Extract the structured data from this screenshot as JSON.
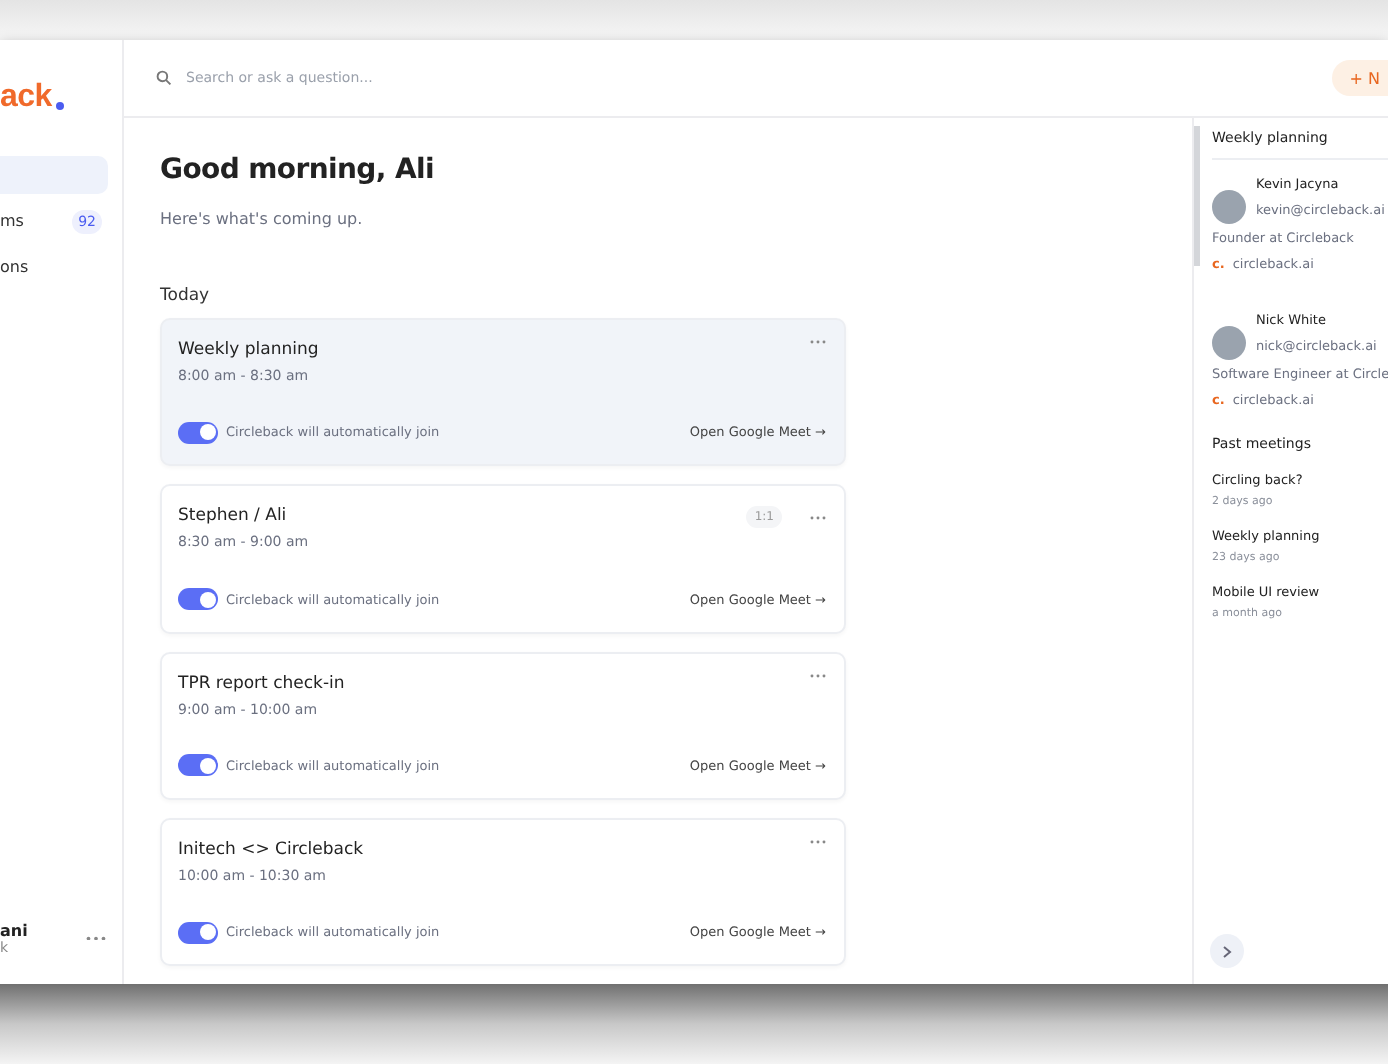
{
  "sidebar": {
    "logo": "ack",
    "items": [
      {
        "selected": true
      },
      {
        "label": "ms",
        "badge": "92",
        "selected": false
      },
      {
        "label": "ons",
        "selected": false
      }
    ],
    "user": {
      "name": "ani",
      "subtitle": "k"
    }
  },
  "header": {
    "search": {
      "placeholder": "Search or ask a question..."
    },
    "new_button": "+ N"
  },
  "greeting": {
    "title": "Good morning, Ali",
    "subtitle": "Here's what's coming up."
  },
  "section": "Today",
  "meetings": [
    {
      "title": "Weekly planning",
      "time": "8:00 am - 8:30 am",
      "selected": true,
      "auto_join": true,
      "join_text": "Circleback will automatically join",
      "link": "Open Google Meet →"
    },
    {
      "title": "Stephen / Ali",
      "time": "8:30 am - 9:00 am",
      "tag": "1:1",
      "selected": false,
      "auto_join": true,
      "join_text": "Circleback will automatically join",
      "link": "Open Google Meet →"
    },
    {
      "title": "TPR report check-in",
      "time": "9:00 am - 10:00 am",
      "selected": false,
      "auto_join": true,
      "join_text": "Circleback will automatically join",
      "link": "Open Google Meet →"
    },
    {
      "title": "Initech <> Circleback",
      "time": "10:00 am - 10:30 am",
      "selected": false,
      "auto_join": true,
      "join_text": "Circleback will automatically join",
      "link": "Open Google Meet →"
    }
  ],
  "detail": {
    "title": "Weekly planning",
    "attendees": [
      {
        "name": "Kevin Jacyna",
        "email": "kevin@circleback.ai",
        "role": "Founder at Circleback",
        "company_mark": "c.",
        "company": "circleback.ai"
      },
      {
        "name": "Nick White",
        "email": "nick@circleback.ai",
        "role": "Software Engineer at Circle",
        "company_mark": "c.",
        "company": "circleback.ai"
      }
    ],
    "past_title": "Past meetings",
    "past": [
      {
        "title": "Circling back?",
        "when": "2 days ago"
      },
      {
        "title": "Weekly planning",
        "when": "23 days ago"
      },
      {
        "title": "Mobile UI review",
        "when": "a month ago"
      }
    ]
  }
}
